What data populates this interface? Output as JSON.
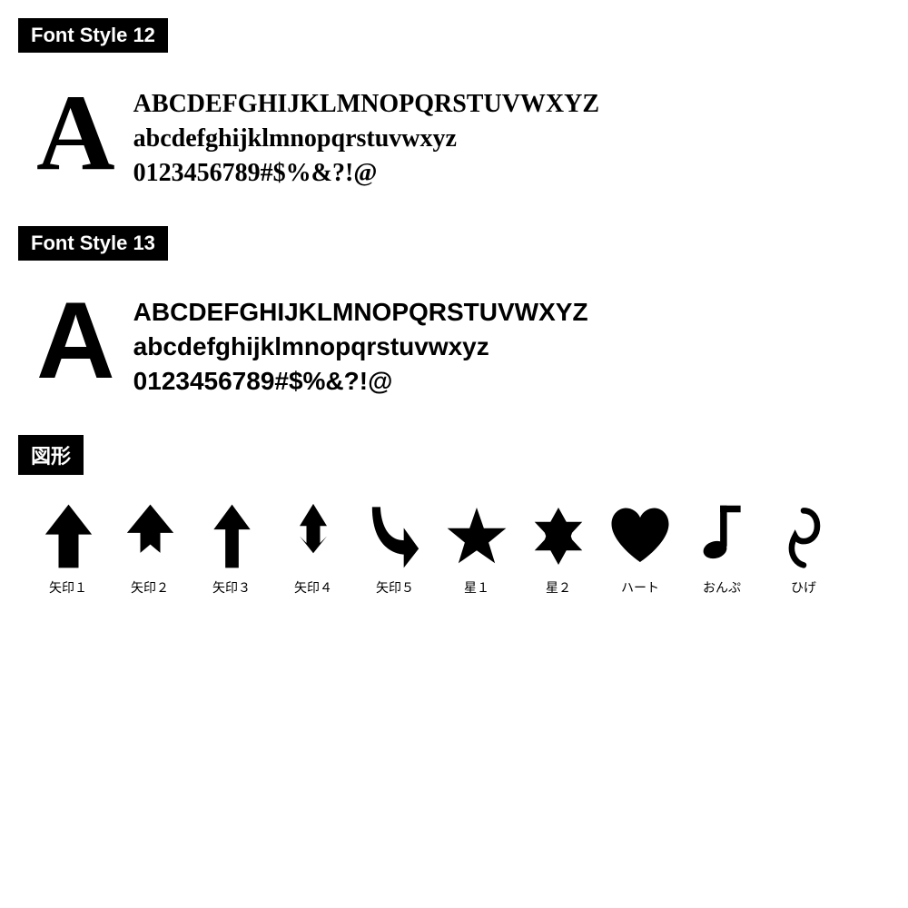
{
  "sections": [
    {
      "id": "font-style-12",
      "label": "Font Style 12",
      "big_letter": "A",
      "lines": [
        "ABCDEFGHIJKLMNOPQRSTUVWXYZ",
        "abcdefghijklmnopqrstuvwxyz",
        "0123456789#$%&?!@"
      ],
      "font_class": "style12"
    },
    {
      "id": "font-style-13",
      "label": "Font Style 13",
      "big_letter": "A",
      "lines": [
        "ABCDEFGHIJKLMNOPQRSTUVWXYZ",
        "abcdefghijklmnopqrstuvwxyz",
        "0123456789#$%&?!@"
      ],
      "font_class": "style13"
    }
  ],
  "shapes_section": {
    "label": "図形",
    "shapes": [
      {
        "id": "yajirushi1",
        "label": "矢印１"
      },
      {
        "id": "yajirushi2",
        "label": "矢印２"
      },
      {
        "id": "yajirushi3",
        "label": "矢印３"
      },
      {
        "id": "yajirushi4",
        "label": "矢印４"
      },
      {
        "id": "yajirushi5",
        "label": "矢印５"
      },
      {
        "id": "hoshi1",
        "label": "星１"
      },
      {
        "id": "hoshi2",
        "label": "星２"
      },
      {
        "id": "heart",
        "label": "ハート"
      },
      {
        "id": "onpu",
        "label": "おんぷ"
      },
      {
        "id": "hige",
        "label": "ひげ"
      }
    ]
  }
}
